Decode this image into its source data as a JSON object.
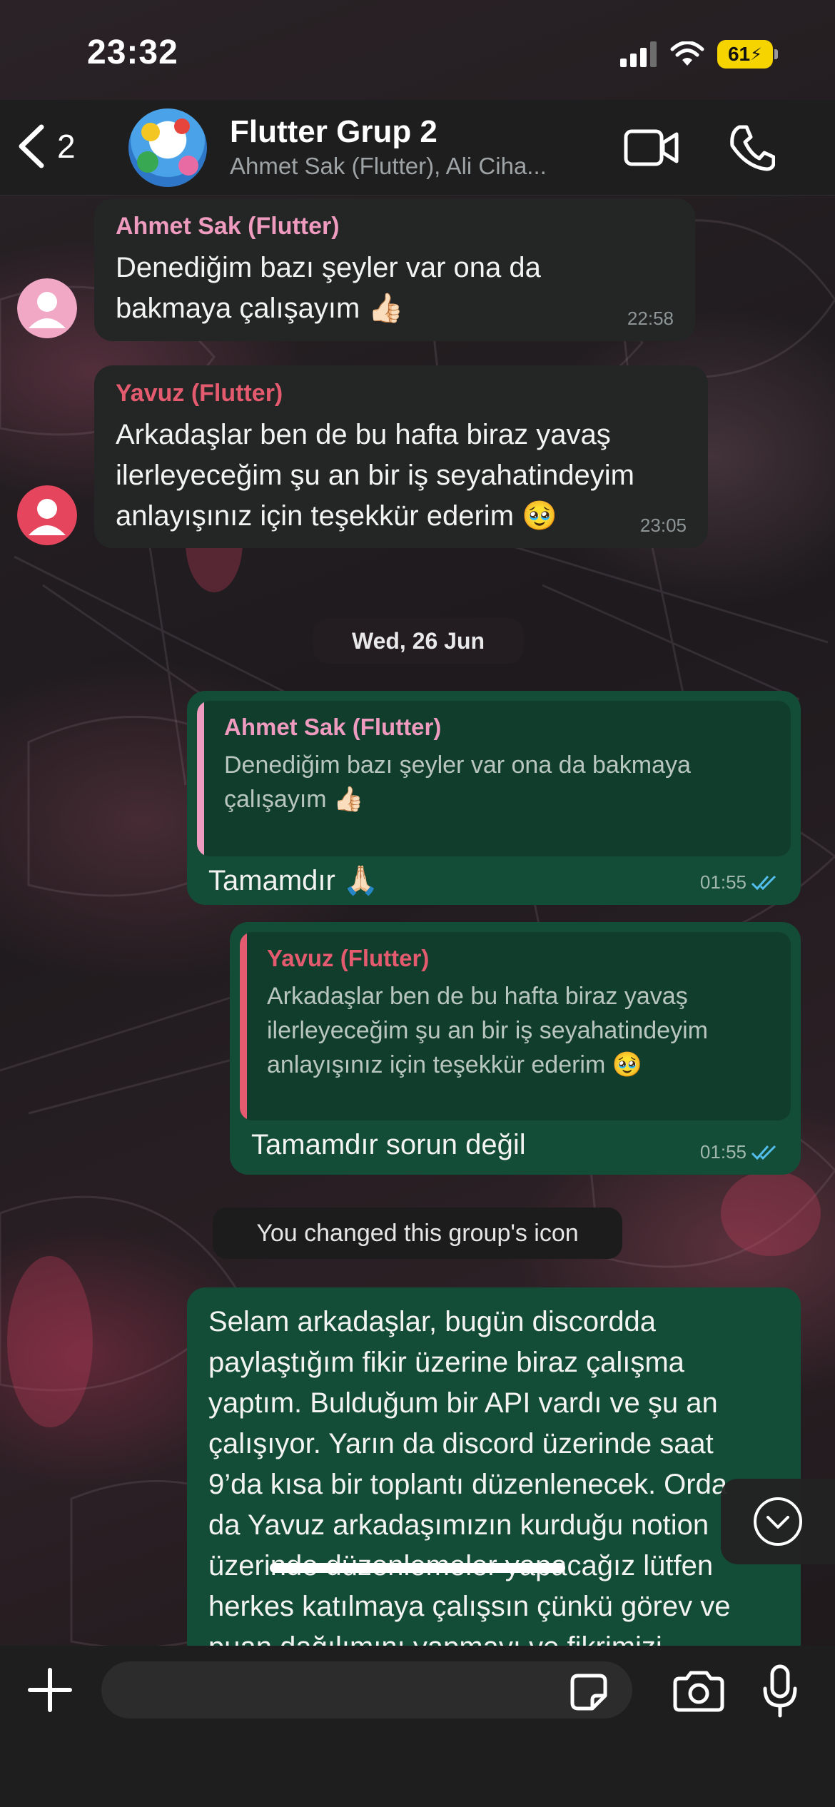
{
  "status_bar": {
    "time": "23:32",
    "battery": "61"
  },
  "header": {
    "back_count": "2",
    "title": "Flutter Grup 2",
    "members": "Ahmet Sak (Flutter), Ali Ciha..."
  },
  "messages": [
    {
      "sender": "Ahmet Sak (Flutter)",
      "sender_color": "#ee9bbf",
      "text_line1": "Denediğim bazı şeyler var ona da",
      "text_line2": "bakmaya çalışayım 👍🏻",
      "time": "22:58"
    },
    {
      "sender": "Yavuz (Flutter)",
      "sender_color": "#e45a6e",
      "text_line1": "Arkadaşlar ben de bu hafta biraz yavaş",
      "text_line2": "ilerleyeceğim şu an bir iş seyahatindeyim",
      "text_line3": "anlayışınız için teşekkür ederim 🥹",
      "time": "23:05"
    }
  ],
  "date_divider": "Wed, 26 Jun",
  "replies": [
    {
      "quoted_sender": "Ahmet Sak (Flutter)",
      "quoted_line1": "Denediğim bazı şeyler var ona da bakmaya",
      "quoted_line2": "çalışayım 👍🏻",
      "text": "Tamamdır 🙏🏻",
      "time": "01:55"
    },
    {
      "quoted_sender": "Yavuz (Flutter)",
      "quoted_line1": "Arkadaşlar ben de bu hafta biraz yavaş",
      "quoted_line2": "ilerleyeceğim şu an bir iş seyahatindeyim",
      "quoted_line3": "anlayışınız için teşekkür ederim 🥹",
      "text": "Tamamdır sorun değil",
      "time": "01:55"
    }
  ],
  "system_message": "You changed this group's icon",
  "long_message": {
    "line1": "Selam arkadaşlar, bugün discordda",
    "line2": "paylaştığım fikir üzerine biraz çalışma",
    "line3": "yaptım. Bulduğum bir API vardı ve şu an",
    "line4": "çalışıyor. Yarın da discord üzerinde saat",
    "line5": "9’da kısa bir toplantı düzenlenecek. Orda",
    "line6": "da Yavuz arkadaşımızın kurduğu notion",
    "line7": "üzerinde düzenlemeler yapacağız lütfen",
    "line8": "herkes katılmaya çalışsın çünkü görev ve",
    "line9": "puan dağılımını yapmayı ve fikrimizi"
  },
  "composer": {
    "placeholder": ""
  },
  "colors": {
    "incoming_bubble": "#242626",
    "outgoing_bubble": "#144d37",
    "read_ticks": "#53bdeb",
    "battery": "#f5d400"
  },
  "icons": [
    "chevron-left-icon",
    "video-camera-icon",
    "phone-icon",
    "plus-icon",
    "sticker-icon",
    "camera-icon",
    "microphone-icon",
    "chevron-down-icon",
    "default-avatar-icon",
    "double-check-icon"
  ]
}
